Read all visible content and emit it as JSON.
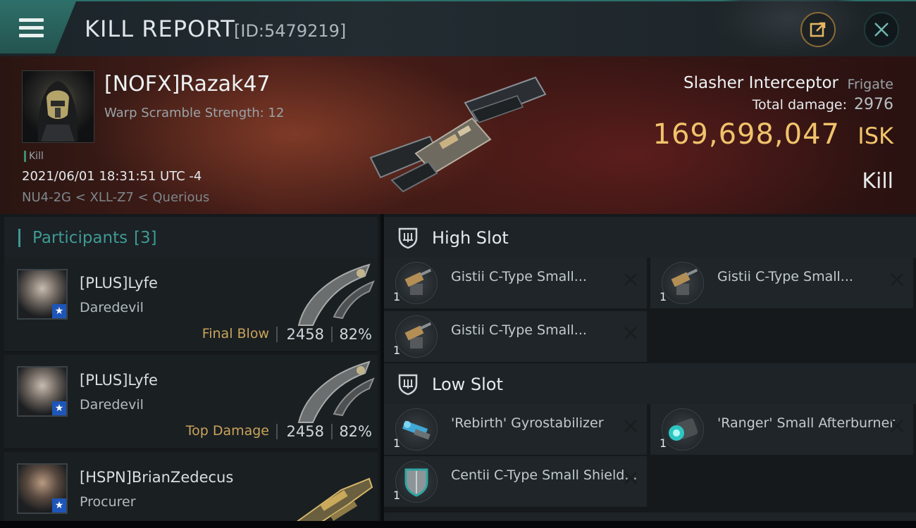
{
  "header": {
    "title": "KILL REPORT",
    "report_id": "[ID:5479219]",
    "menu_icon": "hamburger-menu-icon",
    "share_icon": "share-export-icon",
    "close_icon": "close-icon"
  },
  "victim": {
    "name": "[NOFX]Razak47",
    "warp_scramble": "Warp Scramble Strength: 12",
    "kill_tag": "Kill",
    "timestamp": "2021/06/01 18:31:51 UTC -4",
    "route": "NU4-2G < XLL-Z7 < Querious",
    "ship_name": "Slasher Interceptor",
    "ship_class": "Frigate",
    "total_damage_label": "Total damage:",
    "total_damage": "2976",
    "isk_value": "169,698,047",
    "isk_unit": "ISK",
    "result": "Kill"
  },
  "participants": {
    "label": "Participants",
    "count": "[3]",
    "rows": [
      {
        "name": "[PLUS]Lyfe",
        "ship": "Daredevil",
        "role": "Final Blow",
        "damage": "2458",
        "percent": "82%"
      },
      {
        "name": "[PLUS]Lyfe",
        "ship": "Daredevil",
        "role": "Top Damage",
        "damage": "2458",
        "percent": "82%"
      },
      {
        "name": "[HSPN]BrianZedecus",
        "ship": "Procurer",
        "role": "",
        "damage": "",
        "percent": ""
      }
    ]
  },
  "fittings": {
    "high_slot": {
      "label": "High Slot",
      "modules": [
        {
          "name": "Gistii C-Type Small...",
          "qty": "1"
        },
        {
          "name": "Gistii C-Type Small...",
          "qty": "1"
        },
        {
          "name": "Gistii C-Type Small...",
          "qty": "1"
        }
      ]
    },
    "low_slot": {
      "label": "Low Slot",
      "modules": [
        {
          "name": "'Rebirth' Gyrostabilizer",
          "qty": "1"
        },
        {
          "name": "'Ranger' Small Afterburner",
          "qty": "1"
        },
        {
          "name": "Centii C-Type Small Shield...",
          "qty": "1"
        }
      ]
    }
  },
  "colors": {
    "accent_teal": "#3f9a93",
    "isk_gold": "#f1c36b",
    "role_gold": "#c9a45a"
  }
}
